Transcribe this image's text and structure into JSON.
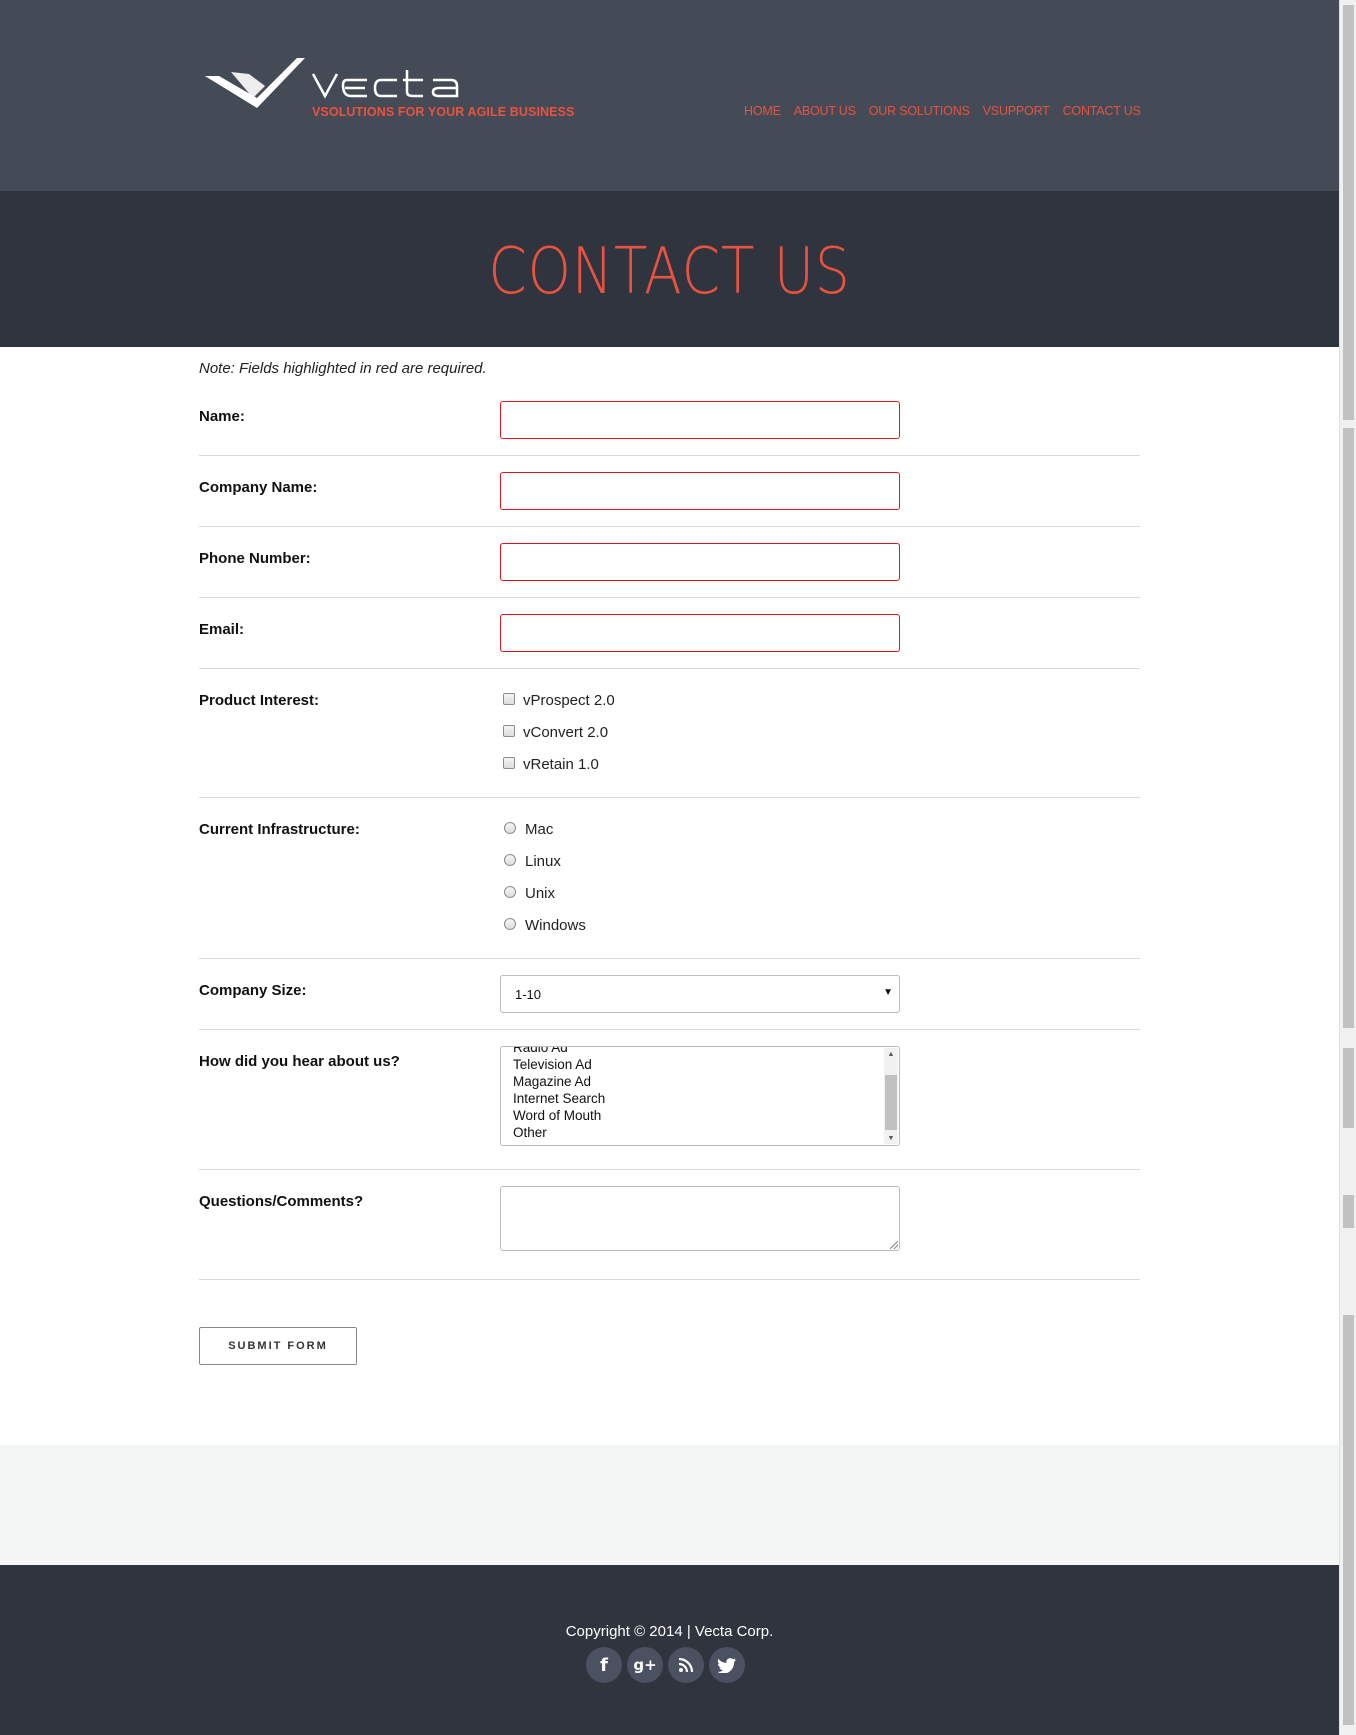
{
  "header": {
    "logo_text": "vecta",
    "tagline": "VSOLUTIONS FOR YOUR AGILE BUSINESS",
    "nav": [
      "HOME",
      "ABOUT US",
      "OUR SOLUTIONS",
      "VSUPPORT",
      "CONTACT US"
    ]
  },
  "banner": {
    "title": "CONTACT US"
  },
  "form": {
    "note": "Note: Fields highlighted in red are required.",
    "name_label": "Name:",
    "name_value": "",
    "company_label": "Company Name:",
    "company_value": "",
    "phone_label": "Phone Number:",
    "phone_value": "",
    "email_label": "Email:",
    "email_value": "",
    "product_label": "Product Interest:",
    "products": [
      "vProspect 2.0",
      "vConvert 2.0",
      "vRetain 1.0"
    ],
    "infra_label": "Current Infrastructure:",
    "infrastructure": [
      "Mac",
      "Linux",
      "Unix",
      "Windows"
    ],
    "size_label": "Company Size:",
    "size_selected": "1-10",
    "hear_label": "How did you hear about us?",
    "hear_options": [
      "Radio Ad",
      "Television Ad",
      "Magazine Ad",
      "Internet Search",
      "Word of Mouth",
      "Other"
    ],
    "comments_label": "Questions/Comments?",
    "comments_value": "",
    "submit_label": "SUBMIT FORM"
  },
  "footer": {
    "copyright": "Copyright © 2014 | Vecta Corp.",
    "socials": [
      "facebook-icon",
      "google-plus-icon",
      "rss-icon",
      "twitter-icon"
    ]
  },
  "colors": {
    "accent": "#e8533f",
    "header_bg": "#454a57",
    "banner_bg": "#2f343f",
    "required_border": "#e0141e"
  }
}
